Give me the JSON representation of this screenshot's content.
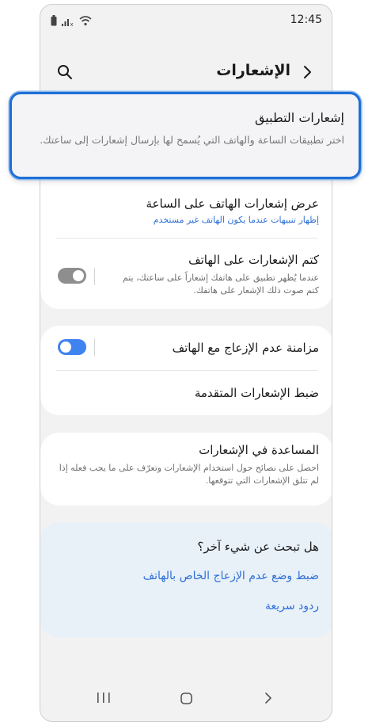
{
  "status_bar": {
    "time": "12:45"
  },
  "app_bar": {
    "title": "الإشعارات"
  },
  "highlight": {
    "title": "إشعارات التطبيق",
    "description": "اختر تطبيقات الساعة والهاتف التي يُسمح لها بإرسال إشعارات إلى ساعتك."
  },
  "settings": {
    "show_phone_notifications": {
      "title": "عرض إشعارات الهاتف على الساعة",
      "subtitle": "إظهار تنبيهات عندما يكون الهاتف غير مستخدم"
    },
    "mute_on_phone": {
      "title": "كتم الإشعارات على الهاتف",
      "subtitle": "عندما يُظهر تطبيق على هاتفك إشعاراً على ساعتك، يتم كتم صوت ذلك الإشعار على هاتفك.",
      "enabled": false
    },
    "sync_dnd": {
      "title": "مزامنة عدم الإزعاج مع الهاتف",
      "enabled": true
    },
    "advanced": {
      "title": "ضبط الإشعارات المتقدمة"
    },
    "help": {
      "title": "المساعدة في الإشعارات",
      "subtitle": "احصل على نصائح حول استخدام الإشعارات وتعرّف على ما يجب فعله إذا لم تتلق الإشعارات التي تتوقعها."
    }
  },
  "suggestions": {
    "heading": "هل تبحث عن شيء آخر؟",
    "links": [
      "ضبط وضع عدم الإزعاج الخاص بالهاتف",
      "ردود سريعة"
    ]
  },
  "colors": {
    "accent": "#2e6fd6",
    "highlight_border": "#1f6fd6",
    "toggle_on": "#3e83f0",
    "toggle_off": "#8e8e8e"
  }
}
